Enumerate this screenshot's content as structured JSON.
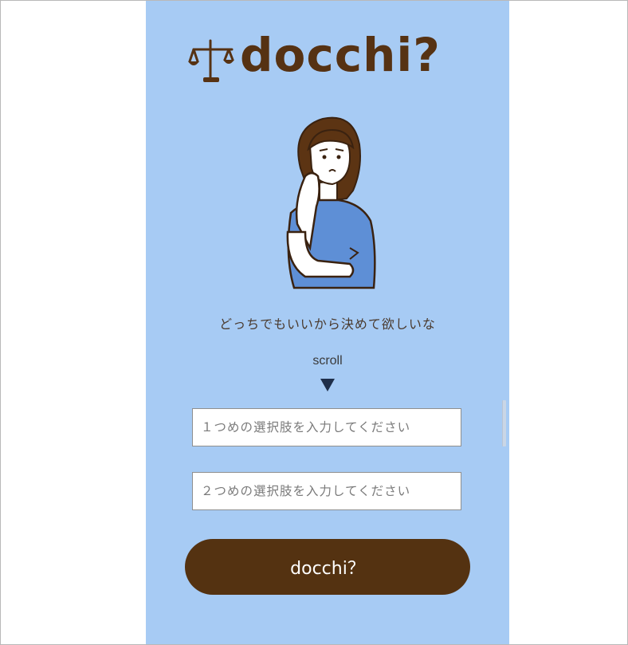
{
  "app": {
    "logo_text": "docchi?"
  },
  "hero": {
    "tagline": "どっちでもいいから決めて欲しいな",
    "scroll_label": "scroll"
  },
  "form": {
    "option1_placeholder": "１つめの選択肢を入力してください",
    "option1_value": "",
    "option2_placeholder": "２つめの選択肢を入力してください",
    "option2_value": "",
    "submit_label": "docchi？"
  },
  "icons": {
    "logo_mark": "balance-scale-icon",
    "scroll_indicator": "triangle-down-icon",
    "illustration": "thinking-woman-illustration"
  },
  "colors": {
    "background": "#a7cbf4",
    "brand_brown": "#563213",
    "button_bg": "#543211"
  }
}
